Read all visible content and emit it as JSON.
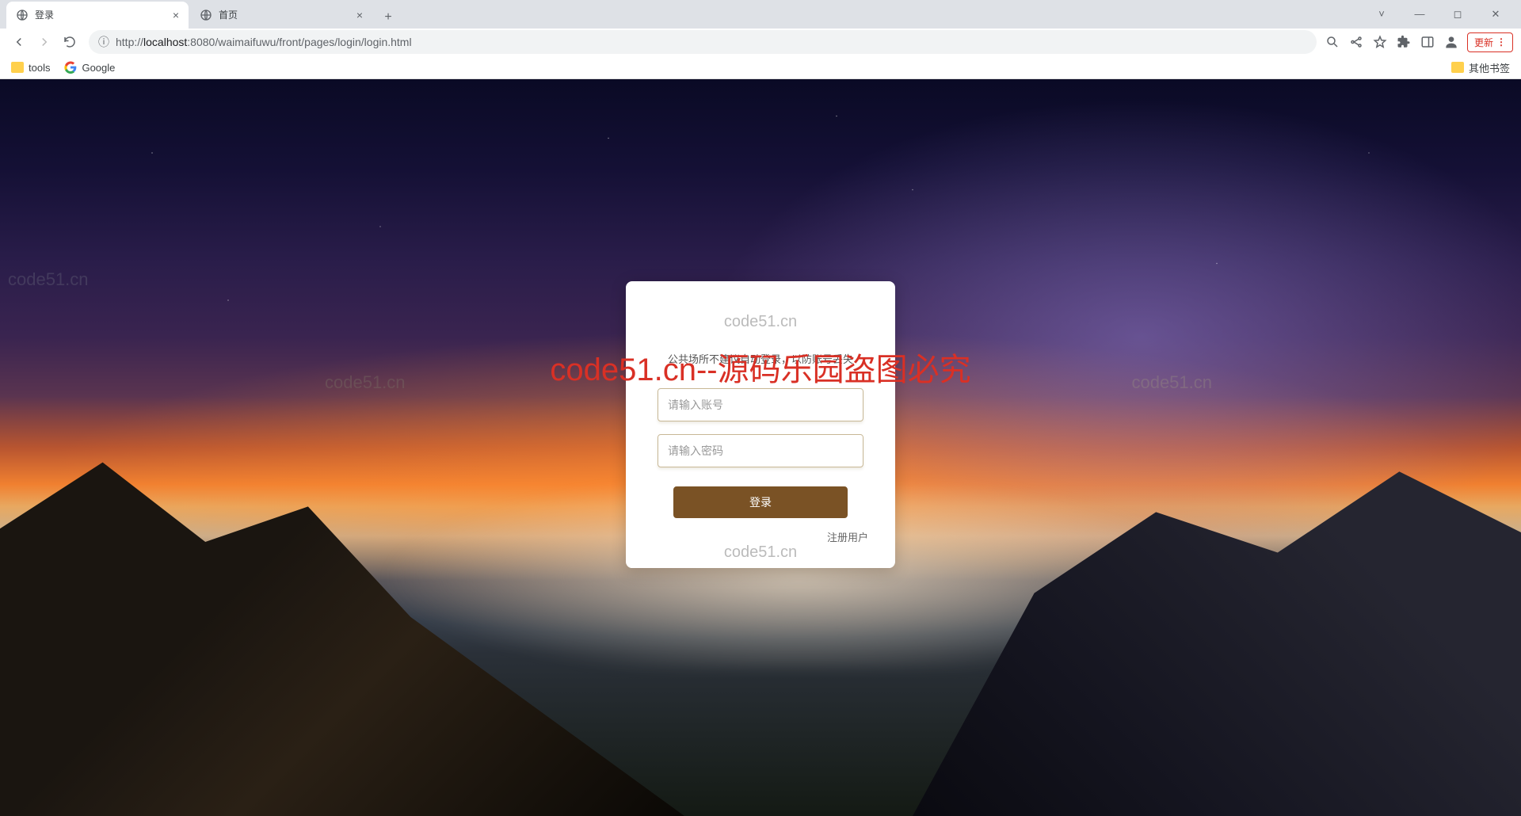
{
  "browser": {
    "tabs": [
      {
        "title": "登录",
        "active": true
      },
      {
        "title": "首页",
        "active": false
      }
    ],
    "url_host": "localhost",
    "url_port": ":8080",
    "url_path": "/waimaifuwu/front/pages/login/login.html",
    "url_prefix": "http://",
    "update_label": "更新",
    "bookmarks": {
      "tools": "tools",
      "google": "Google",
      "other": "其他书签"
    }
  },
  "login": {
    "hint": "公共场所不建议自动登录，以防账号丢失",
    "username_placeholder": "请输入账号",
    "password_placeholder": "请输入密码",
    "button": "登录",
    "register": "注册用户"
  },
  "watermarks": {
    "site": "code51.cn",
    "overlay": "code51.cn--源码乐园盗图必究"
  }
}
